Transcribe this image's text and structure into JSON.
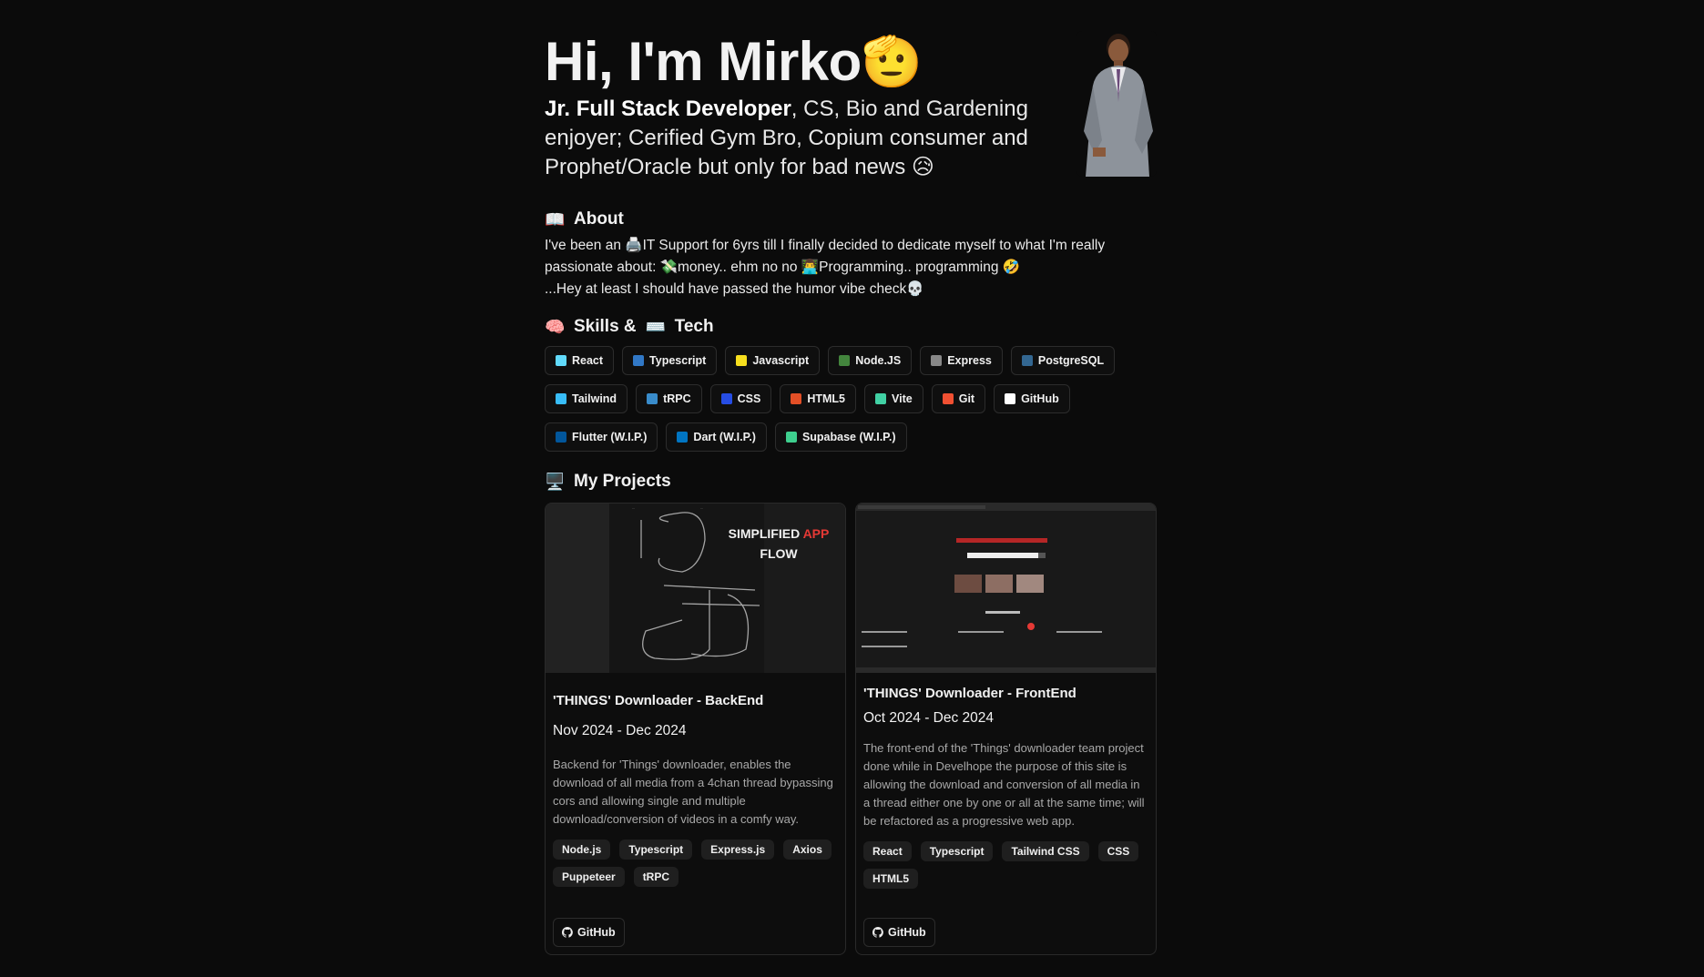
{
  "hero": {
    "name": "Hi, I'm Mirko",
    "name_emoji": "🫡",
    "role": "Jr. Full Stack Developer",
    "tagline_rest": ", CS, Bio and Gardening enjoyer; Cerified Gym Bro, Copium consumer and Prophet/Oracle but only for bad news",
    "tagline_emoji": "😥"
  },
  "about": {
    "icon": "book-icon",
    "title": "About",
    "line1_a": "I've been an ",
    "line1_icon": "🖨️",
    "line1_b": "IT Support for 6yrs till I finally decided to dedicate myself to what I'm really passionate about: ",
    "money_icon": "💸",
    "line1_c": "money.. ehm no no ",
    "coder_icon": "👨‍💻",
    "line1_d": "Programming.. programming ",
    "laugh_icon": "🤣",
    "line2": "...Hey at least I should have passed the humor vibe check",
    "skull_icon": "💀"
  },
  "skills": {
    "title_a": "Skills &",
    "title_b": "Tech",
    "items": [
      {
        "label": "React",
        "icon": "react-icon",
        "color": "#61dafb"
      },
      {
        "label": "Typescript",
        "icon": "typescript-icon",
        "color": "#3178c6"
      },
      {
        "label": "Javascript",
        "icon": "javascript-icon",
        "color": "#f7df1e"
      },
      {
        "label": "Node.JS",
        "icon": "nodejs-icon",
        "color": "#43853d"
      },
      {
        "label": "Express",
        "icon": "express-icon",
        "color": "#888888"
      },
      {
        "label": "PostgreSQL",
        "icon": "postgresql-icon",
        "color": "#336791"
      },
      {
        "label": "Tailwind",
        "icon": "tailwind-icon",
        "color": "#38bdf8"
      },
      {
        "label": "tRPC",
        "icon": "trpc-icon",
        "color": "#398ccb"
      },
      {
        "label": "CSS",
        "icon": "css-icon",
        "color": "#264de4"
      },
      {
        "label": "HTML5",
        "icon": "html5-icon",
        "color": "#e34f26"
      },
      {
        "label": "Vite",
        "icon": "vite-icon",
        "color": "#41d1a4"
      },
      {
        "label": "Git",
        "icon": "git-icon",
        "color": "#f05032"
      },
      {
        "label": "GitHub",
        "icon": "github-icon",
        "color": "#ffffff"
      },
      {
        "label": "Flutter (W.I.P.)",
        "icon": "flutter-icon",
        "color": "#02569b"
      },
      {
        "label": "Dart (W.I.P.)",
        "icon": "dart-icon",
        "color": "#0175c2"
      },
      {
        "label": "Supabase (W.I.P.)",
        "icon": "supabase-icon",
        "color": "#3ecf8e"
      }
    ]
  },
  "projects": {
    "title": "My Projects",
    "cards": [
      {
        "thumb_title_a": "SIMPLIFIED",
        "thumb_title_b": "APP",
        "thumb_title_c": "FLOW",
        "title": "'THINGS' Downloader - BackEnd",
        "date": "Nov 2024 - Dec 2024",
        "desc": "Backend for 'Things' downloader, enables the download of all media from a 4chan thread bypassing cors and allowing single and multiple download/conversion of videos in a comfy way.",
        "tags": [
          "Node.js",
          "Typescript",
          "Express.js",
          "Axios",
          "Puppeteer",
          "tRPC"
        ],
        "github": "GitHub"
      },
      {
        "title": "'THINGS' Downloader - FrontEnd",
        "date": "Oct 2024 - Dec 2024",
        "desc": "The front-end of the 'Things' downloader team project done while in Develhope the purpose of this site is allowing the download and conversion of all media in a thread either one by one or all at the same time; will be refactored as a progressive web app.",
        "tags": [
          "React",
          "Typescript",
          "Tailwind CSS",
          "CSS",
          "HTML5"
        ],
        "github": "GitHub"
      }
    ]
  },
  "colors": {
    "background": "#0b0b0b",
    "card": "#0d0d0d",
    "accent_red": "#e53935"
  }
}
